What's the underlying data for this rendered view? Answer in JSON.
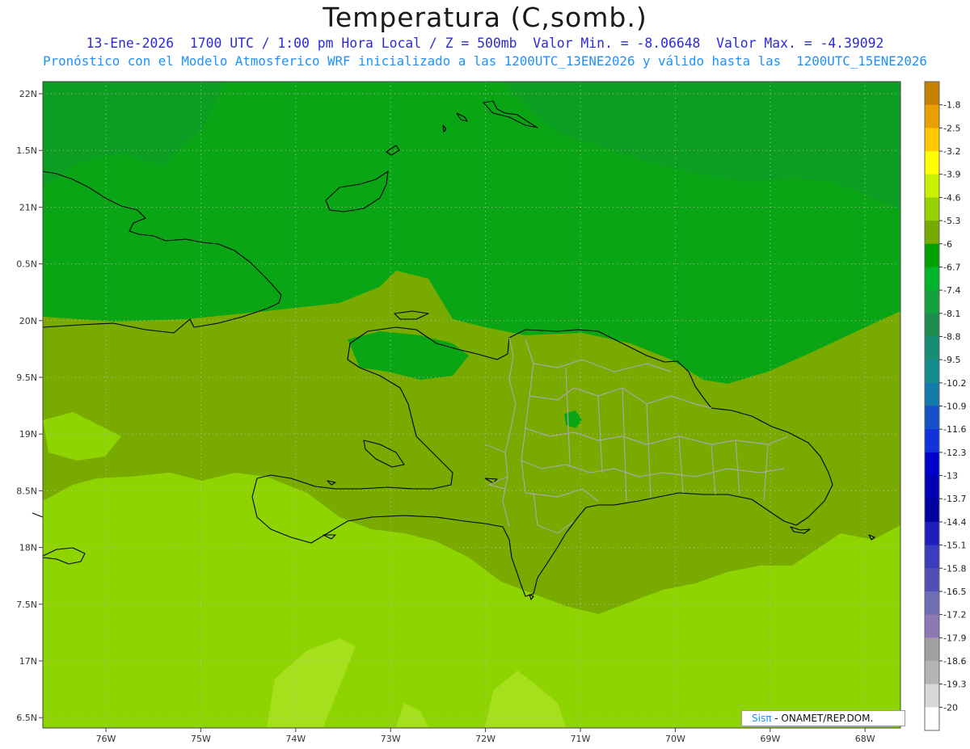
{
  "header": {
    "title": "Temperatura (C,somb.)",
    "line1": "13-Ene-2026  1700 UTC / 1:00 pm Hora Local / Z = 500mb  Valor Min. = -8.06648  Valor Max. = -4.39092",
    "line2": "Pronóstico con el Modelo Atmosferico WRF inicializado a las 1200UTC_13ENE2026 y válido hasta las  1200UTC_15ENE2026"
  },
  "axes": {
    "lat_labels": [
      "22N",
      "1.5N",
      "21N",
      "0.5N",
      "20N",
      "9.5N",
      "19N",
      "8.5N",
      "18N",
      "7.5N",
      "17N",
      "6.5N"
    ],
    "lon_labels": [
      "76W",
      "75W",
      "74W",
      "73W",
      "72W",
      "71W",
      "70W",
      "69W",
      "68W"
    ]
  },
  "colorbar": {
    "labels": [
      "-1.8",
      "-2.5",
      "-3.2",
      "-3.9",
      "-4.6",
      "-5.3",
      "-6",
      "-6.7",
      "-7.4",
      "-8.1",
      "-8.8",
      "-9.5",
      "-10.2",
      "-10.9",
      "-11.6",
      "-12.3",
      "-13",
      "-13.7",
      "-14.4",
      "-15.1",
      "-15.8",
      "-16.5",
      "-17.2",
      "-17.9",
      "-18.6",
      "-19.3",
      "-20"
    ],
    "colors": [
      "#c88000",
      "#e8a000",
      "#ffc800",
      "#ffff00",
      "#c8f000",
      "#96d200",
      "#78aa00",
      "#00a000",
      "#00b42c",
      "#14a03c",
      "#1e8c50",
      "#198c78",
      "#148c8c",
      "#147aaa",
      "#1450c8",
      "#1432dc",
      "#0000c8",
      "#0000b4",
      "#0000a0",
      "#1e1ebe",
      "#3c3cbe",
      "#5050b4",
      "#6e6eb4",
      "#8c78b4",
      "#a0a0a0",
      "#b4b4b4",
      "#d8d8d8",
      "#ffffff"
    ]
  },
  "field_colors": {
    "far_south": "#a6e01c",
    "south": "#8ed400",
    "mid": "#78aa00",
    "north": "#0aa515",
    "far_north": "#0c9e22"
  },
  "credit": {
    "sis": "Sisπ",
    "text": " - ONAMET/REP.DOM."
  }
}
